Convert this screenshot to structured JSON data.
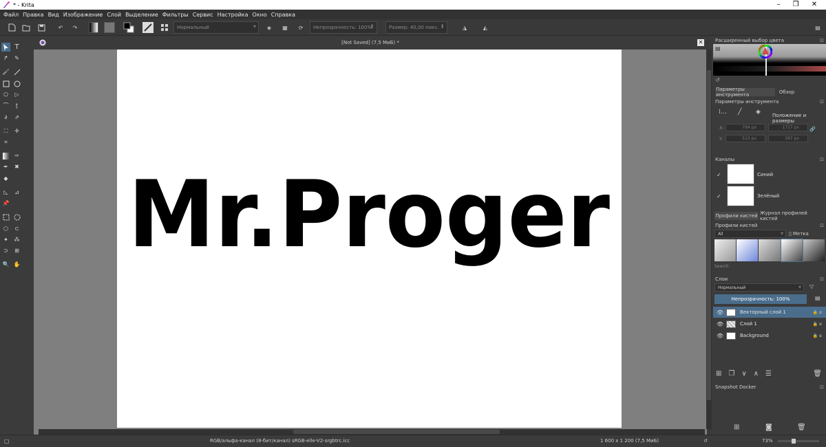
{
  "window": {
    "title": "* - Krita"
  },
  "menu": [
    "Файл",
    "Правка",
    "Вид",
    "Изображение",
    "Слой",
    "Выделение",
    "Фильтры",
    "Сервис",
    "Настройка",
    "Окно",
    "Справка"
  ],
  "toolbar": {
    "blend_mode": "Нормальный",
    "opacity_label": "Непрозрачность: 100%",
    "size_label": "Размер: 40,00 пикс."
  },
  "document": {
    "title": "[Not Saved]  (7,5 МиБ) *",
    "canvas_text": "Mr.Proger"
  },
  "color_docker": {
    "title": "Расширенный выбор цвета"
  },
  "tool_options": {
    "tabs": [
      "Параметры инструмента",
      "Обзор"
    ],
    "title": "Параметры инструмента",
    "section": "Положение и размеры",
    "x_label": "X:",
    "y_label": "Y:",
    "x_value": "794 px",
    "w_value": "1717 px",
    "y_value": "513 px",
    "h_value": "397 px"
  },
  "channels": {
    "title": "Каналы",
    "items": [
      {
        "name": "Синий",
        "checked": "✓"
      },
      {
        "name": "Зелёный",
        "checked": "✓"
      }
    ]
  },
  "brush_tabs": [
    "Профили кистей",
    "Журнал профилей кистей"
  ],
  "brush_presets": {
    "title": "Профили кистей",
    "filter": "All",
    "tag_label": "Метка",
    "search_placeholder": "Search"
  },
  "layers": {
    "title": "Слои",
    "blend_mode": "Нормальный",
    "opacity_label": "Непрозрачность:  100%",
    "items": [
      {
        "name": "Векторный слой 1",
        "selected": true
      },
      {
        "name": "Слой 1",
        "selected": false
      },
      {
        "name": "Background",
        "selected": false
      }
    ]
  },
  "snapshot": {
    "title": "Snapshot Docker"
  },
  "status": {
    "color_profile": "RGB/альфа-канал (8-бит/канал)  sRGB-elle-V2-srgbtrc.icc",
    "image_size": "1 600 x 1 200 (7,5 МиБ)",
    "zoom": "73%"
  },
  "colors": {
    "accent": "#4a6d8c",
    "selected_layer": "#4a6d8c",
    "canvas_bg": "#7f7f7f"
  }
}
